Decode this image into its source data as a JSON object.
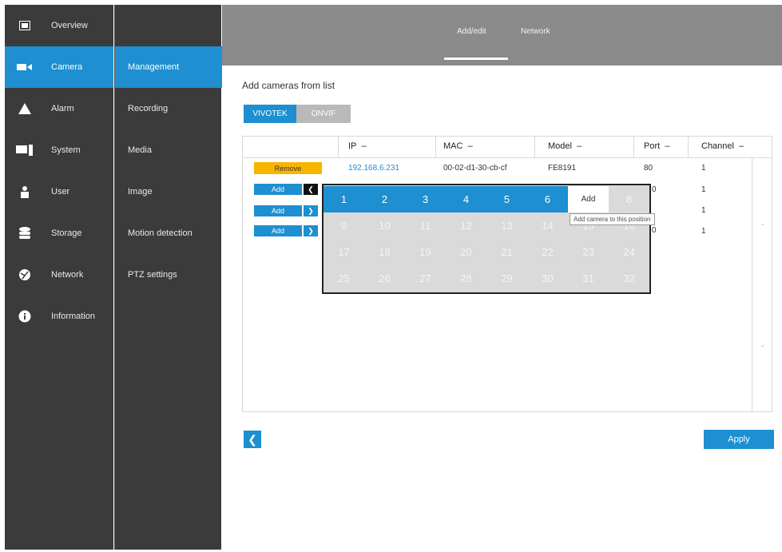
{
  "nav": {
    "items": [
      {
        "label": "Overview",
        "icon": "overview-icon"
      },
      {
        "label": "Camera",
        "icon": "camera-icon"
      },
      {
        "label": "Alarm",
        "icon": "alarm-icon"
      },
      {
        "label": "System",
        "icon": "system-icon"
      },
      {
        "label": "User",
        "icon": "user-icon"
      },
      {
        "label": "Storage",
        "icon": "storage-icon"
      },
      {
        "label": "Network",
        "icon": "network-icon"
      },
      {
        "label": "Information",
        "icon": "information-icon"
      }
    ],
    "active": "Camera"
  },
  "subnav": {
    "items": [
      "Management",
      "Recording",
      "Media",
      "Image",
      "Motion detection",
      "PTZ settings"
    ],
    "active": "Management"
  },
  "tabs": [
    {
      "label": "Add/edit"
    },
    {
      "label": "Network"
    }
  ],
  "heading": "Add cameras from list",
  "source_toggle": {
    "vivotek": "VIVOTEK",
    "onvif": "ONVIF"
  },
  "table": {
    "columns": [
      "IP",
      "MAC",
      "Model",
      "Port",
      "Channel"
    ],
    "row1": {
      "action": "Remove",
      "ip": "192.168.6.231",
      "mac": "00-02-d1-30-cb-cf",
      "model": "FE8191",
      "port": "80",
      "channel": "1"
    },
    "add_label": "Add",
    "channels": [
      "1",
      "1",
      "1"
    ],
    "port_fragments": [
      "0",
      "0"
    ]
  },
  "popup": {
    "positions": [
      "1",
      "2",
      "3",
      "4",
      "5",
      "6",
      "Add",
      "8",
      "9",
      "10",
      "11",
      "12",
      "13",
      "14",
      "15",
      "16",
      "17",
      "18",
      "19",
      "20",
      "21",
      "22",
      "23",
      "24",
      "25",
      "26",
      "27",
      "28",
      "29",
      "30",
      "31",
      "32"
    ],
    "available_count": 6,
    "tooltip": "Add camera to this position"
  },
  "footer": {
    "back_icon": "chevron-left-icon",
    "apply_label": "Apply"
  },
  "colors": {
    "accent": "#1e8fd0",
    "sidebar": "#3b3b3b",
    "remove": "#f7b500",
    "header": "#8a8a8a"
  }
}
